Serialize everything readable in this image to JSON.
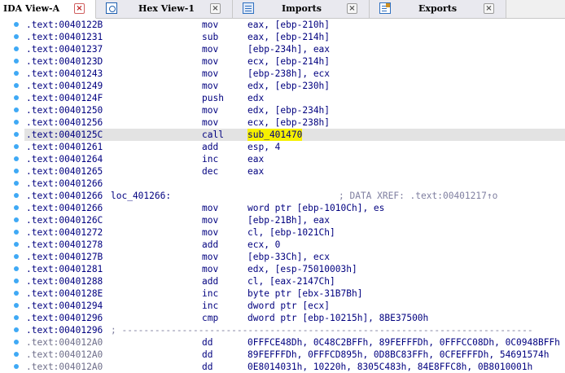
{
  "tabs": [
    {
      "label": "IDA View-A",
      "icon": "",
      "active": true
    },
    {
      "label": "Hex View-1",
      "icon": "hex-view-icon",
      "active": false
    },
    {
      "label": "Imports",
      "icon": "imports-icon",
      "active": false
    },
    {
      "label": "Exports",
      "icon": "exports-icon",
      "active": false
    }
  ],
  "close_glyph": "×",
  "accent_colors": {
    "highlight": "#f6f000",
    "dot": "#3fa9f5",
    "text": "#00007f"
  },
  "rows": [
    {
      "addr": ".text:0040122B",
      "label": "",
      "mnem": "mov",
      "ops": "eax, [ebp-210h]"
    },
    {
      "addr": ".text:00401231",
      "label": "",
      "mnem": "sub",
      "ops": "eax, [ebp-214h]"
    },
    {
      "addr": ".text:00401237",
      "label": "",
      "mnem": "mov",
      "ops": "[ebp-234h], eax"
    },
    {
      "addr": ".text:0040123D",
      "label": "",
      "mnem": "mov",
      "ops": "ecx, [ebp-214h]"
    },
    {
      "addr": ".text:00401243",
      "label": "",
      "mnem": "mov",
      "ops": "[ebp-238h], ecx"
    },
    {
      "addr": ".text:00401249",
      "label": "",
      "mnem": "mov",
      "ops": "edx, [ebp-230h]"
    },
    {
      "addr": ".text:0040124F",
      "label": "",
      "mnem": "push",
      "ops": "edx"
    },
    {
      "addr": ".text:00401250",
      "label": "",
      "mnem": "mov",
      "ops": "edx, [ebp-234h]"
    },
    {
      "addr": ".text:00401256",
      "label": "",
      "mnem": "mov",
      "ops": "ecx, [ebp-238h]"
    },
    {
      "addr": ".text:0040125C",
      "label": "",
      "mnem": "call",
      "ops": "sub_401470",
      "selected": true,
      "highlight": true
    },
    {
      "addr": ".text:00401261",
      "label": "",
      "mnem": "add",
      "ops": "esp, 4"
    },
    {
      "addr": ".text:00401264",
      "label": "",
      "mnem": "inc",
      "ops": "eax"
    },
    {
      "addr": ".text:00401265",
      "label": "",
      "mnem": "dec",
      "ops": "eax"
    },
    {
      "addr": ".text:00401266",
      "label": "",
      "mnem": "",
      "ops": ""
    },
    {
      "addr": ".text:00401266",
      "label": "loc_401266:",
      "mnem": "",
      "ops": "",
      "comment": "; DATA XREF: .text:00401217↑o"
    },
    {
      "addr": ".text:00401266",
      "label": "",
      "mnem": "mov",
      "ops": "word ptr [ebp-1010Ch], es"
    },
    {
      "addr": ".text:0040126C",
      "label": "",
      "mnem": "mov",
      "ops": "[ebp-21Bh], eax"
    },
    {
      "addr": ".text:00401272",
      "label": "",
      "mnem": "mov",
      "ops": "cl, [ebp-1021Ch]"
    },
    {
      "addr": ".text:00401278",
      "label": "",
      "mnem": "add",
      "ops": "ecx, 0"
    },
    {
      "addr": ".text:0040127B",
      "label": "",
      "mnem": "mov",
      "ops": "[ebp-33Ch], ecx"
    },
    {
      "addr": ".text:00401281",
      "label": "",
      "mnem": "mov",
      "ops": "edx, [esp-75010003h]"
    },
    {
      "addr": ".text:00401288",
      "label": "",
      "mnem": "add",
      "ops": "cl, [eax-2147Ch]"
    },
    {
      "addr": ".text:0040128E",
      "label": "",
      "mnem": "inc",
      "ops": "byte ptr [ebx-31B7Bh]"
    },
    {
      "addr": ".text:00401294",
      "label": "",
      "mnem": "inc",
      "ops": "dword ptr [ecx]"
    },
    {
      "addr": ".text:00401296",
      "label": "",
      "mnem": "cmp",
      "ops": "dword ptr [ebp-10215h], 8BE37500h"
    },
    {
      "addr": ".text:00401296",
      "label": "",
      "mnem": "",
      "ops": "",
      "separator": "; ---------------------------------------------------------------------------"
    },
    {
      "addr": ".text:004012A0",
      "label": "",
      "mnem": "dd",
      "ops": "0FFFCE48Dh, 0C48C2BFFh, 89FEFFFDh, 0FFFCC08Dh, 0C0948BFFh",
      "dim": true
    },
    {
      "addr": ".text:004012A0",
      "label": "",
      "mnem": "dd",
      "ops": "89FEFFFDh, 0FFFCD895h, 0D8BC83FFh, 0CFEFFFDh, 54691574h",
      "dim": true
    },
    {
      "addr": ".text:004012A0",
      "label": "",
      "mnem": "dd",
      "ops": "0E8014031h, 10220h, 8305C483h, 84E8FFC8h, 0B8010001h",
      "dim": true
    }
  ]
}
